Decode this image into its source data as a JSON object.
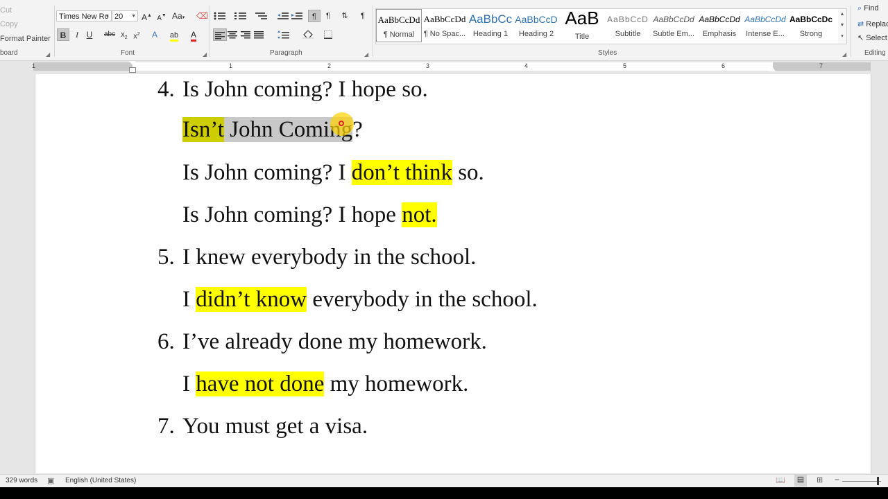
{
  "clipboard": {
    "cut_label": "Cut",
    "copy_label": "Copy",
    "format_painter_label": "Format Painter",
    "group_label": "board"
  },
  "font": {
    "family_value": "Times New Ro",
    "size_value": "20",
    "group_label": "Font"
  },
  "paragraph": {
    "group_label": "Paragraph"
  },
  "styles": {
    "group_label": "Styles",
    "items": [
      {
        "preview": "AaBbCcDd",
        "name": "¶ Normal"
      },
      {
        "preview": "AaBbCcDd",
        "name": "¶ No Spac..."
      },
      {
        "preview": "AaBbCc",
        "name": "Heading 1"
      },
      {
        "preview": "AaBbCcD",
        "name": "Heading 2"
      },
      {
        "preview": "AaB",
        "name": "Title"
      },
      {
        "preview": "AaBbCcD",
        "name": "Subtitle"
      },
      {
        "preview": "AaBbCcDd",
        "name": "Subtle Em..."
      },
      {
        "preview": "AaBbCcDd",
        "name": "Emphasis"
      },
      {
        "preview": "AaBbCcDd",
        "name": "Intense E..."
      },
      {
        "preview": "AaBbCcDc",
        "name": "Strong"
      }
    ]
  },
  "editing": {
    "find_label": "Find",
    "replace_label": "Replac",
    "select_label": "Select",
    "group_label": "Editing"
  },
  "ruler": {
    "numbers": [
      "1",
      "1",
      "2",
      "3",
      "4",
      "5",
      "6",
      "7"
    ]
  },
  "document": {
    "item4": {
      "number": "4.",
      "text": "Is John coming? I hope so.",
      "sub1": {
        "hl": "Isn’t",
        "middle": " John Coming",
        "end": "?"
      },
      "sub2": {
        "pre": "Is John coming? I ",
        "hl": "don’t think",
        "post": " so."
      },
      "sub3": {
        "pre": "Is John coming? I hope ",
        "hl": "not."
      }
    },
    "item5": {
      "number": "5.",
      "text": "I knew everybody in the school.",
      "sub1": {
        "pre": "I ",
        "hl": "didn’t know",
        "post": " everybody in the school."
      }
    },
    "item6": {
      "number": "6.",
      "text": "I’ve already done my homework.",
      "sub1": {
        "pre": "I ",
        "hl": "have not done",
        "post": " my homework."
      }
    },
    "item7": {
      "number": "7.",
      "text": "You must get a visa."
    }
  },
  "status_bar": {
    "word_count": "329 words",
    "language": "English (United States)"
  },
  "colors": {
    "highlight": "#ffff00",
    "selection": "#c8c8c8"
  }
}
